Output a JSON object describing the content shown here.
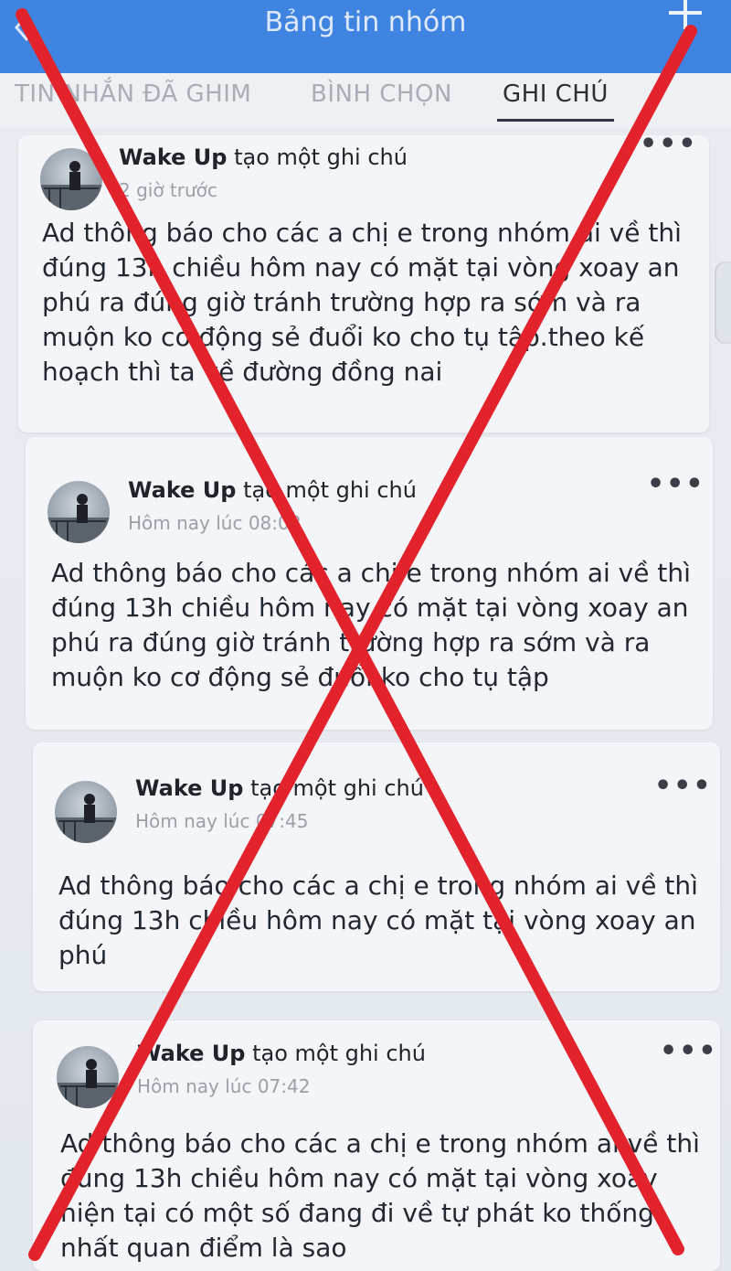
{
  "header": {
    "title": "Bảng tin nhóm"
  },
  "tabs": [
    {
      "label": "TIN NHẮN ĐÃ GHIM",
      "active": false
    },
    {
      "label": "BÌNH CHỌN",
      "active": false
    },
    {
      "label": "GHI CHÚ",
      "active": true
    }
  ],
  "notes": [
    {
      "author": "Wake Up",
      "action": "tạo một ghi chú",
      "time": "2 giờ trước",
      "body": "Ad thông báo cho các a chị e trong nhóm ai về thì\nđúng 13h chiều hôm nay có mặt tại vòng xoay an\nphú ra đúng giờ tránh trường hợp ra sớm và ra\nmuộn ko cơ động sẻ đuổi ko cho tụ tập.theo kế\nhoạch thì ta về đường đồng nai"
    },
    {
      "author": "Wake Up",
      "action": "tạo một ghi chú",
      "time": "Hôm nay lúc 08:08",
      "body": "Ad thông báo cho các a chị e trong nhóm ai về thì\nđúng 13h chiều hôm nay có mặt tại vòng xoay an\nphú ra đúng giờ tránh trường hợp ra sớm và ra\nmuộn ko cơ động sẻ đuổi ko cho tụ tập"
    },
    {
      "author": "Wake Up",
      "action": "tạo một ghi chú",
      "time": "Hôm nay lúc 07:45",
      "body": "Ad thông báo cho các a chị e trong nhóm ai về thì\nđúng 13h chiều hôm nay có mặt tại vòng xoay an\nphú"
    },
    {
      "author": "Wake Up",
      "action": "tạo một ghi chú",
      "time": "Hôm nay lúc 07:42",
      "body": "Ad thông báo cho các a chị e trong nhóm ai về thì\nđúng 13h chiều hôm nay có mặt tại vòng xoay\nhiện tại có một số đang đi về tự phát ko thống\nnhất quan điểm là sao"
    }
  ],
  "more_label": "•••",
  "colors": {
    "header_bg": "#3f84e0",
    "x_overlay": "#e3232c"
  }
}
